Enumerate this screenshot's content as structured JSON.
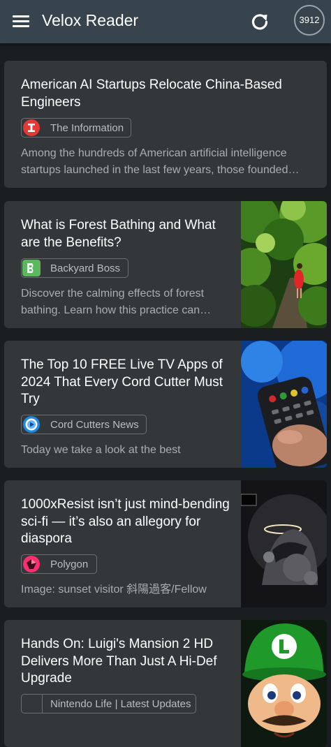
{
  "app": {
    "title": "Velox Reader",
    "unread_count": "3912"
  },
  "articles": [
    {
      "title": "American AI Startups Relocate China-Based Engineers",
      "source": "The Information",
      "snippet_line1": "Among the hundreds of American artificial intelligence",
      "snippet_line2": "startups launched in the last few years, those founded…",
      "source_logo_icon": "information-logo-icon",
      "source_color": "#e53935",
      "thumbnail_icon": ""
    },
    {
      "title": "What is Forest Bathing and What are the Benefits?",
      "source": "Backyard Boss",
      "snippet_line1": "Discover the calming effects of forest",
      "snippet_line2": "bathing. Learn how this practice can…",
      "source_logo_icon": "backyard-boss-logo-icon",
      "source_color": "#4caf50",
      "thumbnail_icon": "forest-thumbnail"
    },
    {
      "title": "The Top 10 FREE Live TV Apps of 2024 That Every Cord Cutter Must Try",
      "source": "Cord Cutters News",
      "snippet_line1": "Today we take a look at the best",
      "source_logo_icon": "cord-cutters-logo-icon",
      "source_color": "#1e88e5",
      "thumbnail_icon": "tv-remote-thumbnail"
    },
    {
      "title": "1000xResist isn’t just mind-bending sci-fi — it’s also an allegory for diaspora",
      "source": "Polygon",
      "snippet_line1": "Image: sunset visitor 斜陽過客/Fellow",
      "source_logo_icon": "polygon-logo-icon",
      "source_color": "#ff3a5e",
      "thumbnail_icon": "sci-fi-helmet-thumbnail"
    },
    {
      "title": "Hands On: Luigi's Mansion 2 HD Delivers More Than Just A Hi-Def Upgrade",
      "source": "Nintendo Life | Latest Updates",
      "source_logo_icon": "nintendo-life-logo-icon",
      "source_color": "#2a2d30",
      "thumbnail_icon": "luigi-thumbnail"
    }
  ]
}
